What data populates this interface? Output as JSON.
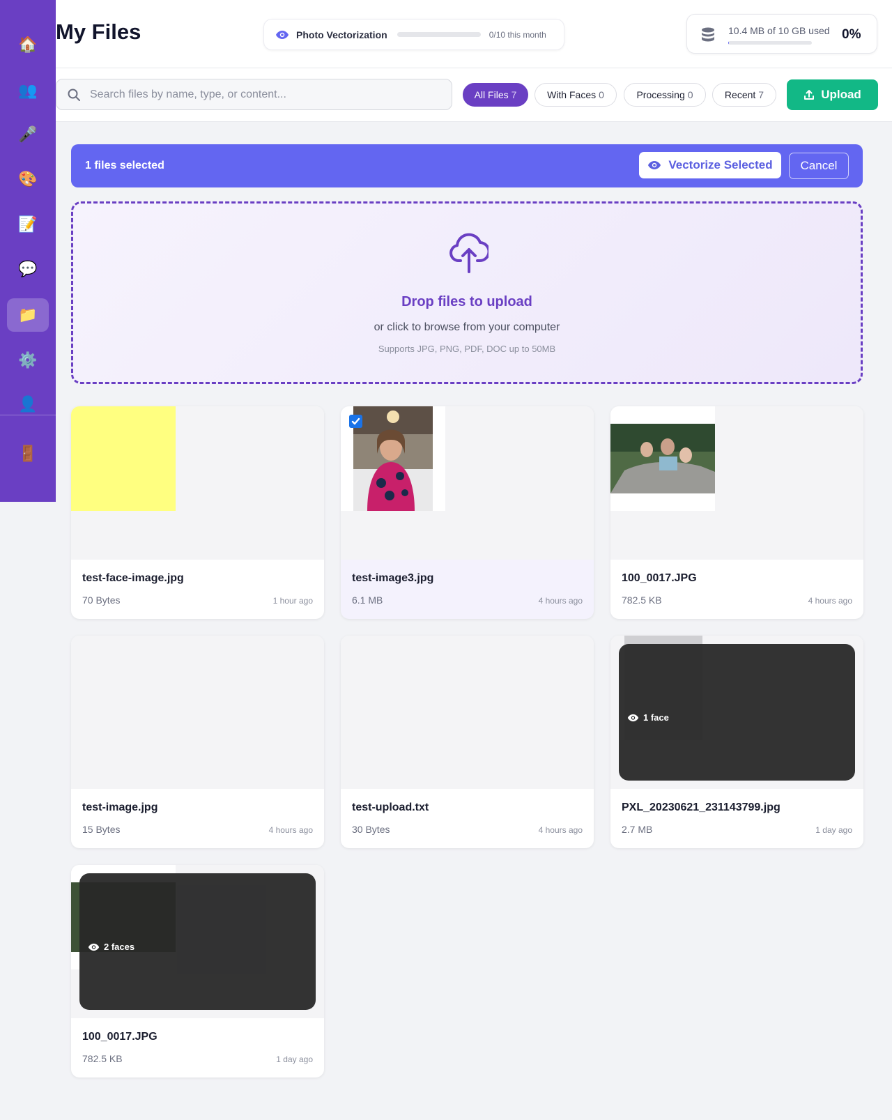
{
  "header": {
    "title": "My Files",
    "quota": {
      "label": "Photo Vectorization",
      "count": "0/10 this month",
      "progress": 0
    },
    "storage": {
      "text": "10.4 MB of 10 GB used",
      "percent": "0%",
      "progress": 0.001
    }
  },
  "toolbar": {
    "search_placeholder": "Search files by name, type, or content...",
    "chips": [
      {
        "label": "All Files",
        "count": "7"
      },
      {
        "label": "With Faces",
        "count": "0"
      },
      {
        "label": "Processing",
        "count": "0"
      },
      {
        "label": "Recent",
        "count": "7"
      }
    ],
    "upload_label": "Upload"
  },
  "selection": {
    "count_text": "1 files selected",
    "vectorize_label": "Vectorize Selected",
    "cancel_label": "Cancel"
  },
  "dropzone": {
    "title": "Drop files to upload",
    "subtitle": "or click to browse from your computer",
    "note": "Supports JPG, PNG, PDF, DOC up to 50MB"
  },
  "files": [
    {
      "name": "test-face-image.jpg",
      "size": "70 Bytes",
      "time": "1 hour ago"
    },
    {
      "name": "test-image3.jpg",
      "size": "6.1 MB",
      "time": "4 hours ago"
    },
    {
      "name": "100_0017.JPG",
      "size": "782.5 KB",
      "time": "4 hours ago"
    },
    {
      "name": "test-image.jpg",
      "size": "15 Bytes",
      "time": "4 hours ago"
    },
    {
      "name": "test-upload.txt",
      "size": "30 Bytes",
      "time": "4 hours ago"
    },
    {
      "name": "PXL_20230621_231143799.jpg",
      "size": "2.7 MB",
      "time": "1 day ago",
      "faces": "1 face"
    },
    {
      "name": "100_0017.JPG",
      "size": "782.5 KB",
      "time": "1 day ago",
      "faces": "2 faces"
    }
  ],
  "icons": {
    "nav": [
      "home-icon",
      "users-icon",
      "microphone-icon",
      "palette-icon",
      "memo-icon",
      "chat-icon",
      "folder-icon",
      "gear-icon",
      "user-icon",
      "door-icon"
    ],
    "colors": {
      "sidebar": "#6a3fc3",
      "accent": "#6366f1",
      "upload": "#12b886"
    }
  }
}
